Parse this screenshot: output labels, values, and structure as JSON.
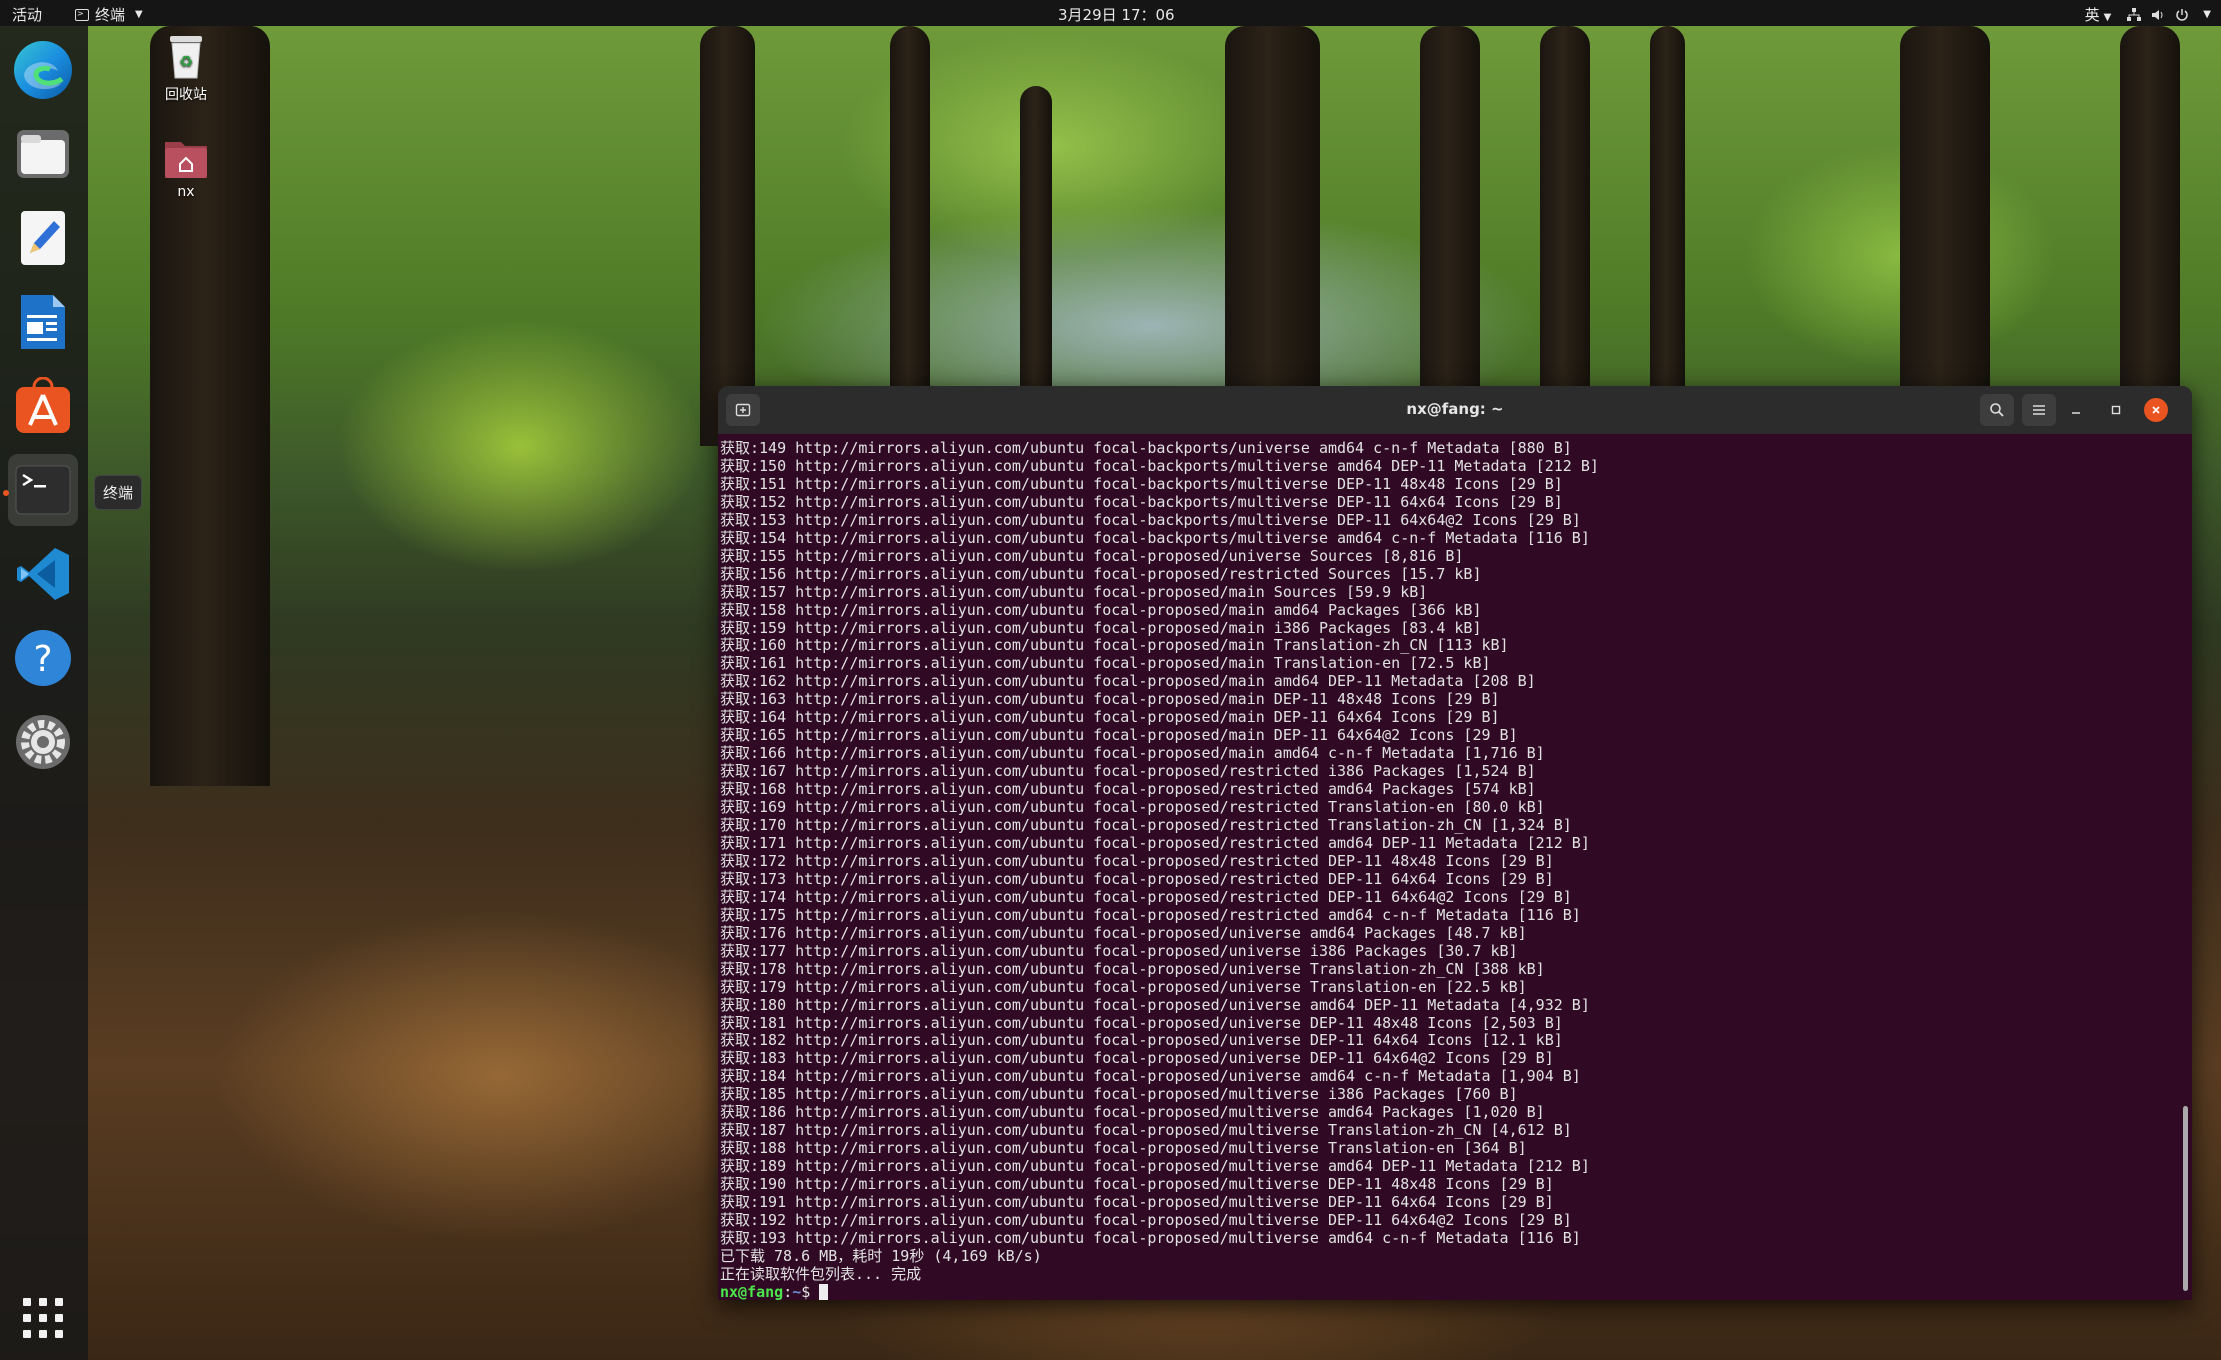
{
  "topbar": {
    "activities": "活动",
    "app_name": "终端",
    "clock": "3月29日 17：06",
    "input_method": "英"
  },
  "dock": {
    "tooltip": "终端",
    "items": [
      {
        "name": "edge-browser",
        "icon": "edge-icon"
      },
      {
        "name": "files",
        "icon": "folder-icon"
      },
      {
        "name": "text-editor",
        "icon": "text-editor-icon"
      },
      {
        "name": "libreoffice-writer",
        "icon": "writer-icon"
      },
      {
        "name": "ubuntu-software",
        "icon": "software-store-icon"
      },
      {
        "name": "terminal",
        "icon": "terminal-icon"
      },
      {
        "name": "vscode",
        "icon": "vscode-icon"
      },
      {
        "name": "help",
        "icon": "help-icon"
      },
      {
        "name": "settings",
        "icon": "settings-icon"
      },
      {
        "name": "show-applications",
        "icon": "app-grid-icon"
      }
    ]
  },
  "desktop": {
    "trash_label": "回收站",
    "home_label": "nx"
  },
  "terminal": {
    "title": "nx@fang: ~",
    "lines": [
      "获取:149 http://mirrors.aliyun.com/ubuntu focal-backports/universe amd64 c-n-f Metadata [880 B]",
      "获取:150 http://mirrors.aliyun.com/ubuntu focal-backports/multiverse amd64 DEP-11 Metadata [212 B]",
      "获取:151 http://mirrors.aliyun.com/ubuntu focal-backports/multiverse DEP-11 48x48 Icons [29 B]",
      "获取:152 http://mirrors.aliyun.com/ubuntu focal-backports/multiverse DEP-11 64x64 Icons [29 B]",
      "获取:153 http://mirrors.aliyun.com/ubuntu focal-backports/multiverse DEP-11 64x64@2 Icons [29 B]",
      "获取:154 http://mirrors.aliyun.com/ubuntu focal-backports/multiverse amd64 c-n-f Metadata [116 B]",
      "获取:155 http://mirrors.aliyun.com/ubuntu focal-proposed/universe Sources [8,816 B]",
      "获取:156 http://mirrors.aliyun.com/ubuntu focal-proposed/restricted Sources [15.7 kB]",
      "获取:157 http://mirrors.aliyun.com/ubuntu focal-proposed/main Sources [59.9 kB]",
      "获取:158 http://mirrors.aliyun.com/ubuntu focal-proposed/main amd64 Packages [366 kB]",
      "获取:159 http://mirrors.aliyun.com/ubuntu focal-proposed/main i386 Packages [83.4 kB]",
      "获取:160 http://mirrors.aliyun.com/ubuntu focal-proposed/main Translation-zh_CN [113 kB]",
      "获取:161 http://mirrors.aliyun.com/ubuntu focal-proposed/main Translation-en [72.5 kB]",
      "获取:162 http://mirrors.aliyun.com/ubuntu focal-proposed/main amd64 DEP-11 Metadata [208 B]",
      "获取:163 http://mirrors.aliyun.com/ubuntu focal-proposed/main DEP-11 48x48 Icons [29 B]",
      "获取:164 http://mirrors.aliyun.com/ubuntu focal-proposed/main DEP-11 64x64 Icons [29 B]",
      "获取:165 http://mirrors.aliyun.com/ubuntu focal-proposed/main DEP-11 64x64@2 Icons [29 B]",
      "获取:166 http://mirrors.aliyun.com/ubuntu focal-proposed/main amd64 c-n-f Metadata [1,716 B]",
      "获取:167 http://mirrors.aliyun.com/ubuntu focal-proposed/restricted i386 Packages [1,524 B]",
      "获取:168 http://mirrors.aliyun.com/ubuntu focal-proposed/restricted amd64 Packages [574 kB]",
      "获取:169 http://mirrors.aliyun.com/ubuntu focal-proposed/restricted Translation-en [80.0 kB]",
      "获取:170 http://mirrors.aliyun.com/ubuntu focal-proposed/restricted Translation-zh_CN [1,324 B]",
      "获取:171 http://mirrors.aliyun.com/ubuntu focal-proposed/restricted amd64 DEP-11 Metadata [212 B]",
      "获取:172 http://mirrors.aliyun.com/ubuntu focal-proposed/restricted DEP-11 48x48 Icons [29 B]",
      "获取:173 http://mirrors.aliyun.com/ubuntu focal-proposed/restricted DEP-11 64x64 Icons [29 B]",
      "获取:174 http://mirrors.aliyun.com/ubuntu focal-proposed/restricted DEP-11 64x64@2 Icons [29 B]",
      "获取:175 http://mirrors.aliyun.com/ubuntu focal-proposed/restricted amd64 c-n-f Metadata [116 B]",
      "获取:176 http://mirrors.aliyun.com/ubuntu focal-proposed/universe amd64 Packages [48.7 kB]",
      "获取:177 http://mirrors.aliyun.com/ubuntu focal-proposed/universe i386 Packages [30.7 kB]",
      "获取:178 http://mirrors.aliyun.com/ubuntu focal-proposed/universe Translation-zh_CN [388 kB]",
      "获取:179 http://mirrors.aliyun.com/ubuntu focal-proposed/universe Translation-en [22.5 kB]",
      "获取:180 http://mirrors.aliyun.com/ubuntu focal-proposed/universe amd64 DEP-11 Metadata [4,932 B]",
      "获取:181 http://mirrors.aliyun.com/ubuntu focal-proposed/universe DEP-11 48x48 Icons [2,503 B]",
      "获取:182 http://mirrors.aliyun.com/ubuntu focal-proposed/universe DEP-11 64x64 Icons [12.1 kB]",
      "获取:183 http://mirrors.aliyun.com/ubuntu focal-proposed/universe DEP-11 64x64@2 Icons [29 B]",
      "获取:184 http://mirrors.aliyun.com/ubuntu focal-proposed/universe amd64 c-n-f Metadata [1,904 B]",
      "获取:185 http://mirrors.aliyun.com/ubuntu focal-proposed/multiverse i386 Packages [760 B]",
      "获取:186 http://mirrors.aliyun.com/ubuntu focal-proposed/multiverse amd64 Packages [1,020 B]",
      "获取:187 http://mirrors.aliyun.com/ubuntu focal-proposed/multiverse Translation-zh_CN [4,612 B]",
      "获取:188 http://mirrors.aliyun.com/ubuntu focal-proposed/multiverse Translation-en [364 B]",
      "获取:189 http://mirrors.aliyun.com/ubuntu focal-proposed/multiverse amd64 DEP-11 Metadata [212 B]",
      "获取:190 http://mirrors.aliyun.com/ubuntu focal-proposed/multiverse DEP-11 48x48 Icons [29 B]",
      "获取:191 http://mirrors.aliyun.com/ubuntu focal-proposed/multiverse DEP-11 64x64 Icons [29 B]",
      "获取:192 http://mirrors.aliyun.com/ubuntu focal-proposed/multiverse DEP-11 64x64@2 Icons [29 B]",
      "获取:193 http://mirrors.aliyun.com/ubuntu focal-proposed/multiverse amd64 c-n-f Metadata [116 B]",
      "已下载 78.6 MB，耗时 19秒 (4,169 kB/s)",
      "正在读取软件包列表... 完成"
    ],
    "prompt_user": "nx@fang",
    "prompt_sep": ":",
    "prompt_path": "~",
    "prompt_symbol": "$ "
  }
}
